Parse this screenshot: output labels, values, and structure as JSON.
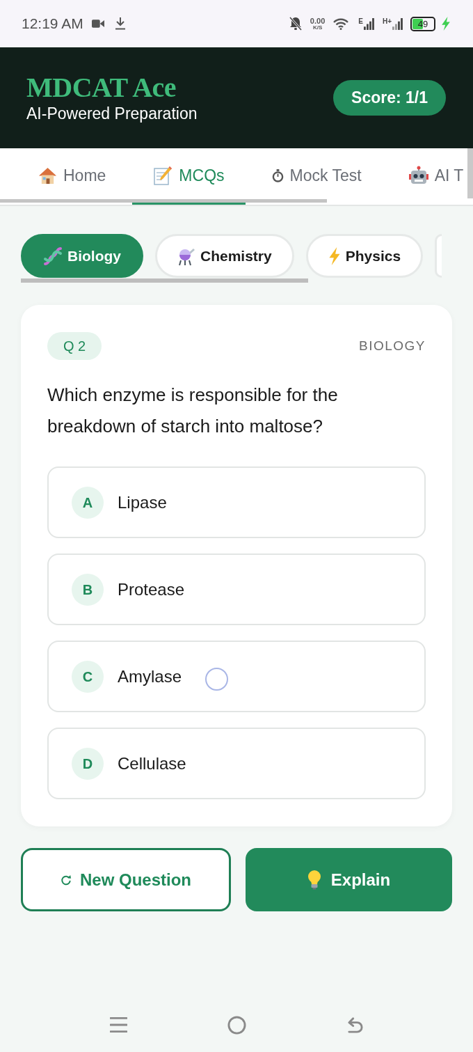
{
  "status_bar": {
    "time": "12:19 AM",
    "speed": "0.00",
    "speed_unit": "K/S",
    "network_1": "E",
    "network_2": "H+",
    "battery": "49",
    "charging": true
  },
  "header": {
    "title": "MDCAT Ace",
    "subtitle": "AI-Powered Preparation",
    "score": "Score: 1/1"
  },
  "tabs": [
    {
      "label": "Home",
      "selected": false
    },
    {
      "label": "MCQs",
      "selected": true
    },
    {
      "label": "Mock Test",
      "selected": false
    },
    {
      "label": "AI T",
      "selected": false
    }
  ],
  "subjects": [
    {
      "label": "Biology",
      "selected": true
    },
    {
      "label": "Chemistry",
      "selected": false
    },
    {
      "label": "Physics",
      "selected": false
    }
  ],
  "question": {
    "number": "Q 2",
    "subject": "BIOLOGY",
    "text": "Which enzyme is responsible for the breakdown of starch into maltose?",
    "options": [
      {
        "letter": "A",
        "text": "Lipase",
        "touched": false
      },
      {
        "letter": "B",
        "text": "Protease",
        "touched": false
      },
      {
        "letter": "C",
        "text": "Amylase",
        "touched": true
      },
      {
        "letter": "D",
        "text": "Cellulase",
        "touched": false
      }
    ]
  },
  "buttons": [
    {
      "label": "New Question",
      "kind": "outline"
    },
    {
      "label": "Explain",
      "kind": "filled"
    }
  ]
}
